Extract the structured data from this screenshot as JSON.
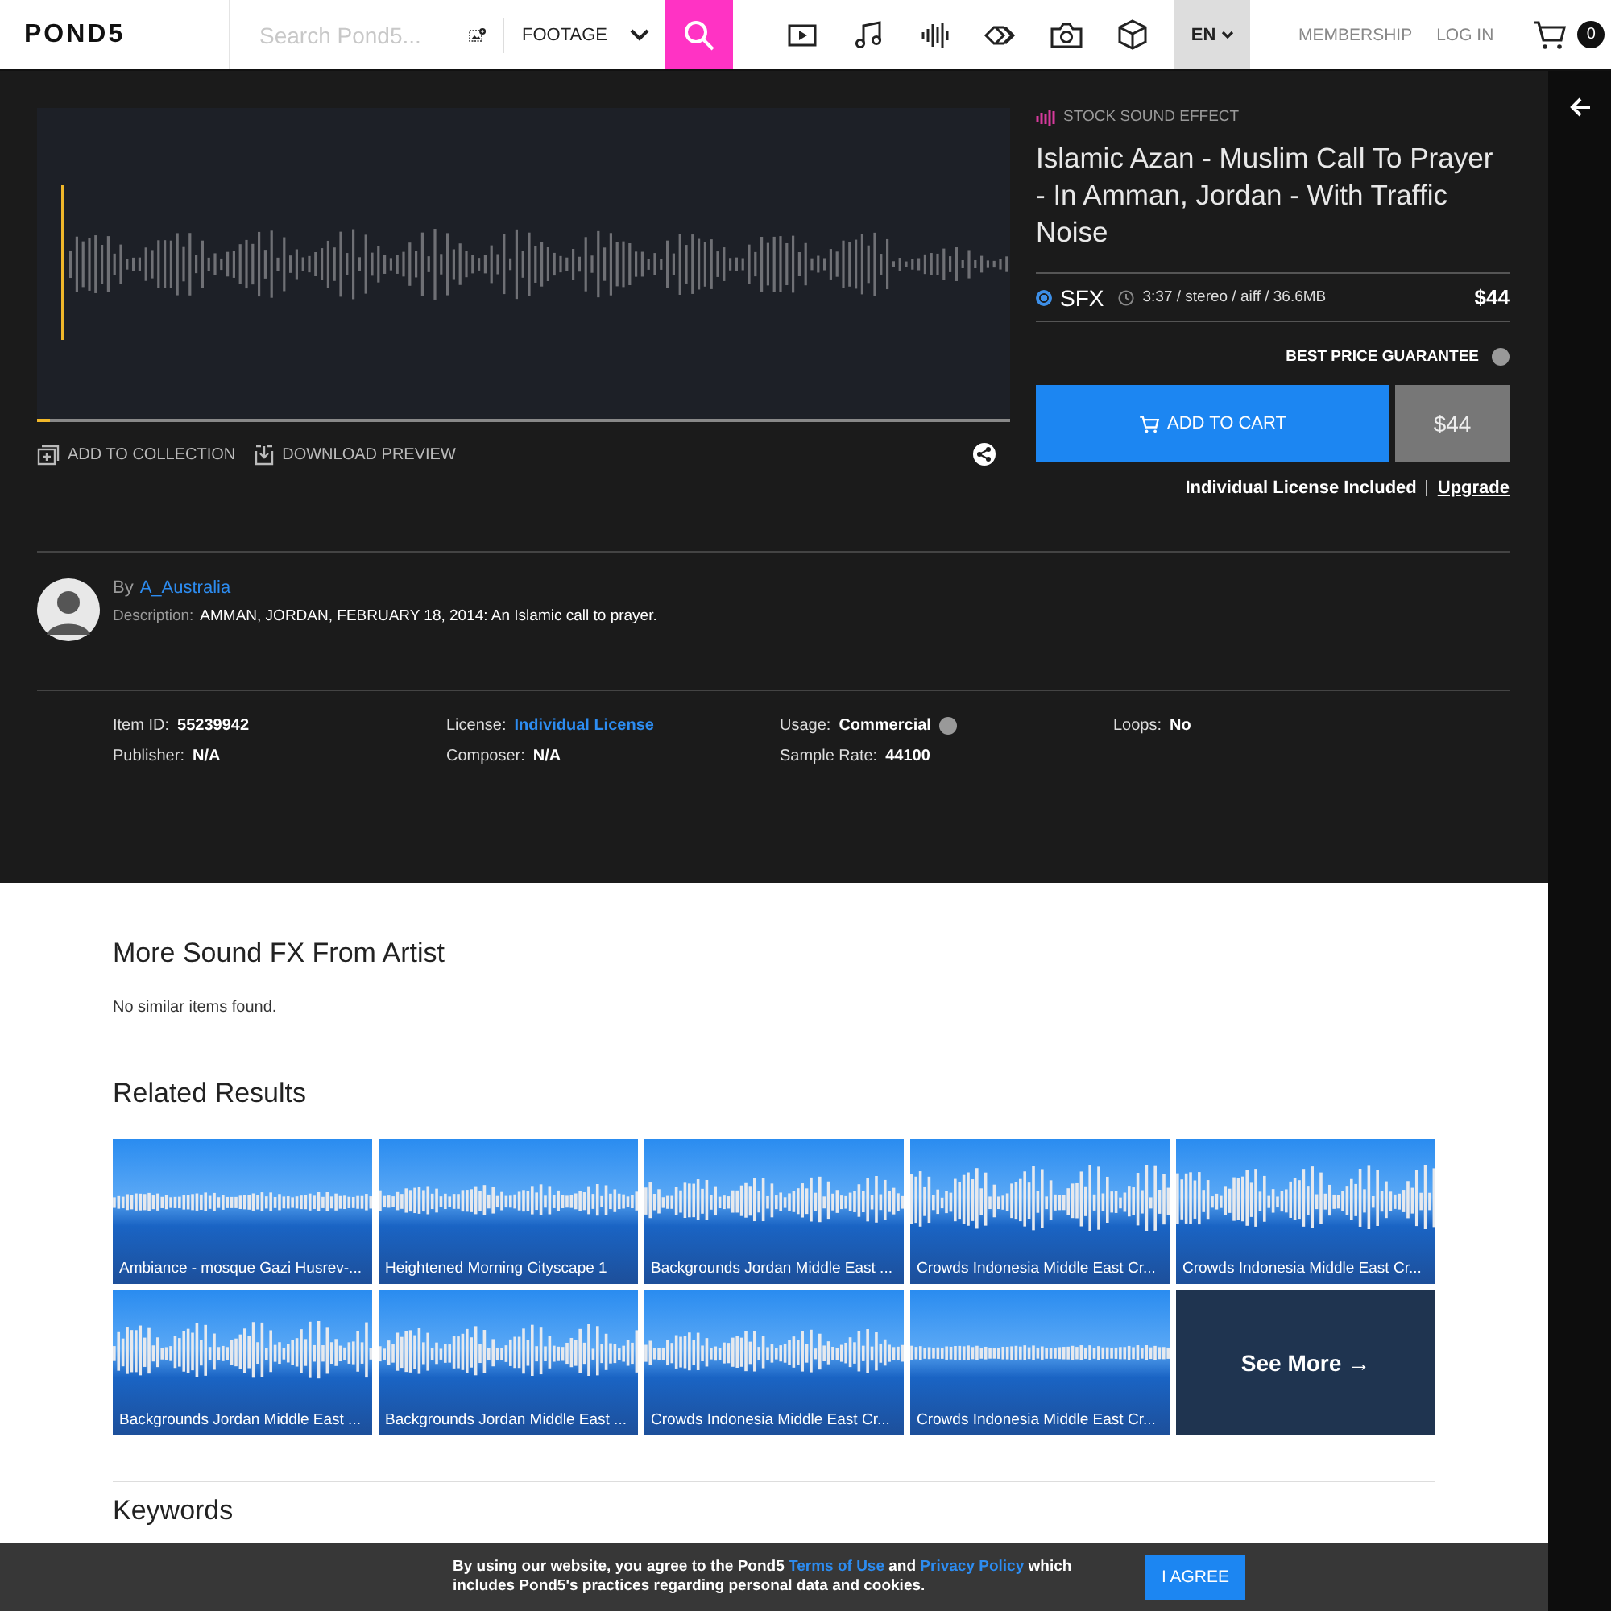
{
  "header": {
    "logo": "POND5",
    "search_placeholder": "Search Pond5...",
    "category": "FOOTAGE",
    "media_types": [
      {
        "kind": "video",
        "selected": false
      },
      {
        "kind": "music",
        "selected": false
      },
      {
        "kind": "sfx",
        "selected": false
      },
      {
        "kind": "motion",
        "selected": false
      },
      {
        "kind": "photo",
        "selected": false
      },
      {
        "kind": "model",
        "selected": false
      }
    ],
    "language": "EN",
    "links": [
      "MEMBERSHIP",
      "LOG IN"
    ],
    "cart_count": "0"
  },
  "player": {
    "level": 0.013,
    "actions": [
      {
        "kind": "collection",
        "label": "ADD TO COLLECTION"
      },
      {
        "kind": "download",
        "label": "DOWNLOAD PREVIEW"
      }
    ]
  },
  "product": {
    "category": "STOCK SOUND EFFECT",
    "title": "Islamic Azan - Muslim Call To Prayer - In Amman, Jordan - With Traffic Noise",
    "option": {
      "label": "SFX",
      "meta": "3:37 / stereo / aiff / 36.6MB",
      "price": "$44",
      "selected": true
    },
    "best_price": "BEST PRICE GUARANTEE",
    "add_to_cart": "ADD TO CART",
    "cart_price": "$44",
    "license_note": "Individual License Included",
    "upgrade": "Upgrade"
  },
  "artist": {
    "by": "By",
    "name": "A_Australia",
    "description_label": "Description:",
    "description": "AMMAN, JORDAN, FEBRUARY 18, 2014: An Islamic call to prayer."
  },
  "details": [
    {
      "label": "Item ID:",
      "value": "55239942",
      "kind": "text",
      "help": false
    },
    {
      "label": "License:",
      "value": "Individual License",
      "kind": "link",
      "help": false
    },
    {
      "label": "Usage:",
      "value": "Commercial",
      "kind": "text",
      "help": true
    },
    {
      "label": "Loops:",
      "value": "No",
      "kind": "text",
      "help": false
    },
    {
      "label": "Publisher:",
      "value": "N/A",
      "kind": "text",
      "help": false
    },
    {
      "label": "Composer:",
      "value": "N/A",
      "kind": "text",
      "help": false
    },
    {
      "label": "Sample Rate:",
      "value": "44100",
      "kind": "text",
      "help": false
    }
  ],
  "more_from_artist": {
    "heading": "More Sound FX From Artist",
    "empty": "No similar items found."
  },
  "related": {
    "heading": "Related Results",
    "items": [
      {
        "title": "Ambiance - mosque Gazi Husrev-..."
      },
      {
        "title": "Heightened Morning Cityscape 1"
      },
      {
        "title": "Backgrounds Jordan Middle East ..."
      },
      {
        "title": "Crowds Indonesia Middle East Cr..."
      },
      {
        "title": "Crowds Indonesia Middle East Cr..."
      },
      {
        "title": "Backgrounds Jordan Middle East ..."
      },
      {
        "title": "Backgrounds Jordan Middle East ..."
      },
      {
        "title": "Crowds Indonesia Middle East Cr..."
      },
      {
        "title": "Crowds Indonesia Middle East Cr..."
      }
    ],
    "see_more": "See More →"
  },
  "keywords": {
    "heading": "Keywords"
  },
  "cookie": {
    "parts": [
      {
        "kind": "text",
        "text": "By using our website, you agree to the Pond5"
      },
      {
        "kind": "link",
        "text": "Terms of Use"
      },
      {
        "kind": "text",
        "text": "and"
      },
      {
        "kind": "link",
        "text": "Privacy Policy"
      },
      {
        "kind": "text",
        "text": "which includes Pond5's practices regarding personal data and cookies."
      }
    ],
    "button": "I AGREE"
  }
}
